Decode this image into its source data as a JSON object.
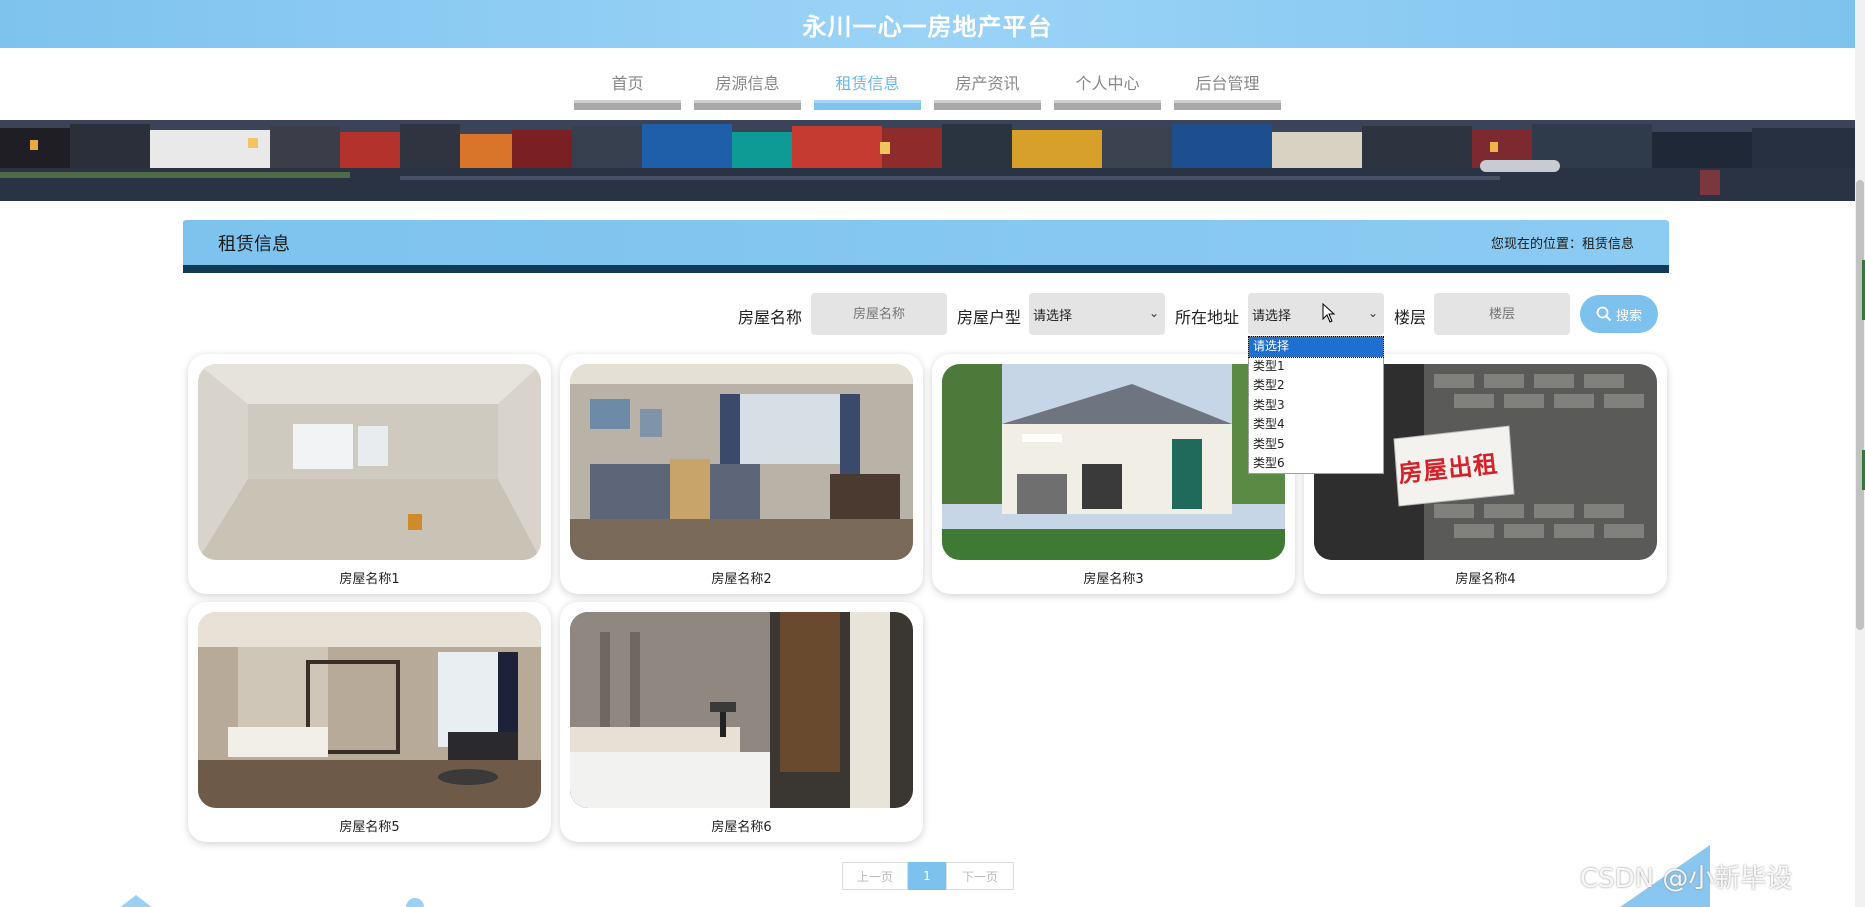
{
  "app": {
    "title": "永川一心一房地产平台"
  },
  "nav": {
    "items": [
      {
        "label": "首页"
      },
      {
        "label": "房源信息"
      },
      {
        "label": "租赁信息"
      },
      {
        "label": "房产资讯"
      },
      {
        "label": "个人中心"
      },
      {
        "label": "后台管理"
      }
    ],
    "active_index": 2
  },
  "section": {
    "title": "租赁信息",
    "breadcrumb": "您现在的位置：租赁信息"
  },
  "search": {
    "name_label": "房屋名称",
    "name_placeholder": "房屋名称",
    "type_label": "房屋户型",
    "type_value": "请选择",
    "address_label": "所在地址",
    "address_value": "请选择",
    "floor_label": "楼层",
    "floor_placeholder": "楼层",
    "button_label": "搜索",
    "address_options": [
      "请选择",
      "类型1",
      "类型2",
      "类型3",
      "类型4",
      "类型5",
      "类型6"
    ]
  },
  "listings": [
    {
      "name": "房屋名称1",
      "image": "empty-room-photo"
    },
    {
      "name": "房屋名称2",
      "image": "bedroom-photo"
    },
    {
      "name": "房屋名称3",
      "image": "villa-photo"
    },
    {
      "name": "房屋名称4",
      "image": "for-rent-sign-photo",
      "sign_text": "房屋出租"
    },
    {
      "name": "房屋名称5",
      "image": "luxury-bedroom-photo"
    },
    {
      "name": "房屋名称6",
      "image": "modern-bedroom-photo"
    }
  ],
  "pager": {
    "prev": "上一页",
    "current": "1",
    "next": "下一页"
  },
  "watermark": "CSDN @小新毕设",
  "colors": {
    "accent": "#7dc1ee",
    "header_dark": "#113a58",
    "dropdown_selected": "#1e6fd0"
  }
}
